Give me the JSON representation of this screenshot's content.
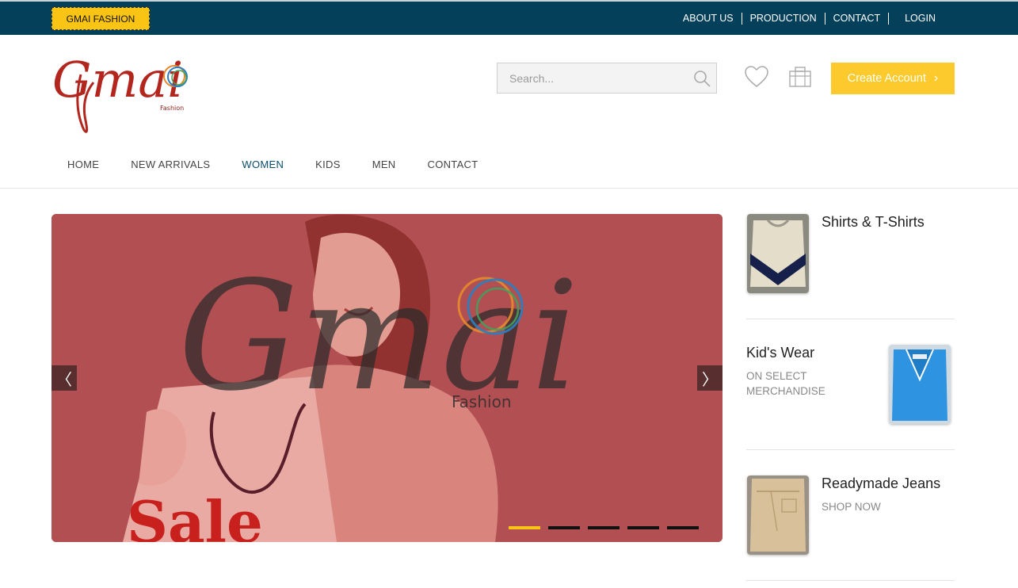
{
  "topbar": {
    "brand_badge": "GMAI FASHION",
    "links": [
      "ABOUT US",
      "PRODUCTION",
      "CONTACT",
      "LOGIN"
    ]
  },
  "header": {
    "logo_text": "Gmai",
    "logo_sub": "Fashion",
    "search_placeholder": "Search...",
    "create_account": "Create Account",
    "icons": [
      "search-icon",
      "heart-icon",
      "shopping-bag-icon",
      "chevron-right-icon"
    ]
  },
  "nav": {
    "items": [
      "HOME",
      "NEW ARRIVALS",
      "WOMEN",
      "KIDS",
      "MEN",
      "CONTACT"
    ],
    "active": "WOMEN"
  },
  "slider": {
    "watermark_title": "Gmai",
    "watermark_sub": "Fashion",
    "bag_text": "Sale",
    "slide_count": 5,
    "active_slide": 1,
    "prev_glyph": "〈",
    "next_glyph": "〉"
  },
  "categories": [
    {
      "title": "Shirts & T-Shirts",
      "subtitle": ""
    },
    {
      "title": "Kid's Wear",
      "subtitle": "ON SELECT MERCHANDISE"
    },
    {
      "title": "Readymade Jeans",
      "subtitle": "SHOP NOW"
    }
  ],
  "colors": {
    "topbar": "#05405b",
    "accent_yellow": "#f9c413",
    "button_yellow": "#fcca2c",
    "slide_red": "#b14f52",
    "active_nav": "#0a4d6b"
  }
}
